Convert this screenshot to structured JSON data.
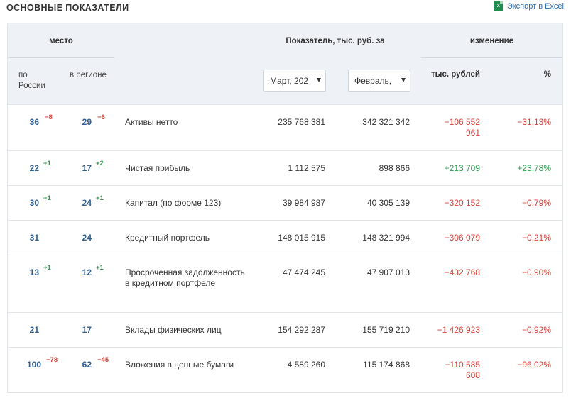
{
  "header": {
    "section_title": "ОСНОВНЫЕ ПОКАЗАТЕЛИ",
    "export_label": "Экспорт в Excel",
    "export_icon": "excel-icon"
  },
  "table_header": {
    "mesto": "место",
    "po_rossii": "по России",
    "v_regione": "в регионе",
    "pokazatel": "Показатель, тыс. руб. за",
    "period1": "Март, 202",
    "period2": "Февраль,",
    "izmenenie": "изменение",
    "tys_rublei": "тыс. рублей",
    "percent": "%"
  },
  "rows": [
    {
      "rank_ru": "36",
      "delta_ru": "−8",
      "rank_reg": "29",
      "delta_reg": "−6",
      "name": "Активы нетто",
      "v1": "235 768 381",
      "v2": "342 321 342",
      "chg": "−106 552 961",
      "pct": "−31,13%"
    },
    {
      "rank_ru": "22",
      "delta_ru": "+1",
      "rank_reg": "17",
      "delta_reg": "+2",
      "name": "Чистая прибыль",
      "v1": "1 112 575",
      "v2": "898 866",
      "chg": "+213 709",
      "pct": "+23,78%"
    },
    {
      "rank_ru": "30",
      "delta_ru": "+1",
      "rank_reg": "24",
      "delta_reg": "+1",
      "name": "Капитал (по форме 123)",
      "v1": "39 984 987",
      "v2": "40 305 139",
      "chg": "−320 152",
      "pct": "−0,79%"
    },
    {
      "rank_ru": "31",
      "delta_ru": "",
      "rank_reg": "24",
      "delta_reg": "",
      "name": "Кредитный портфель",
      "v1": "148 015 915",
      "v2": "148 321 994",
      "chg": "−306 079",
      "pct": "−0,21%"
    },
    {
      "rank_ru": "13",
      "delta_ru": "+1",
      "rank_reg": "12",
      "delta_reg": "+1",
      "name": "Просроченная задолженность в кредитном портфеле",
      "v1": "47 474 245",
      "v2": "47 907 013",
      "chg": "−432 768",
      "pct": "−0,90%"
    },
    {
      "rank_ru": "21",
      "delta_ru": "",
      "rank_reg": "17",
      "delta_reg": "",
      "name": "Вклады физических лиц",
      "v1": "154 292 287",
      "v2": "155 719 210",
      "chg": "−1 426 923",
      "pct": "−0,92%"
    },
    {
      "rank_ru": "100",
      "delta_ru": "−78",
      "rank_reg": "62",
      "delta_reg": "−45",
      "name": "Вложения в ценные бумаги",
      "v1": "4 589 260",
      "v2": "115 174 868",
      "chg": "−110 585 608",
      "pct": "−96,02%"
    }
  ]
}
